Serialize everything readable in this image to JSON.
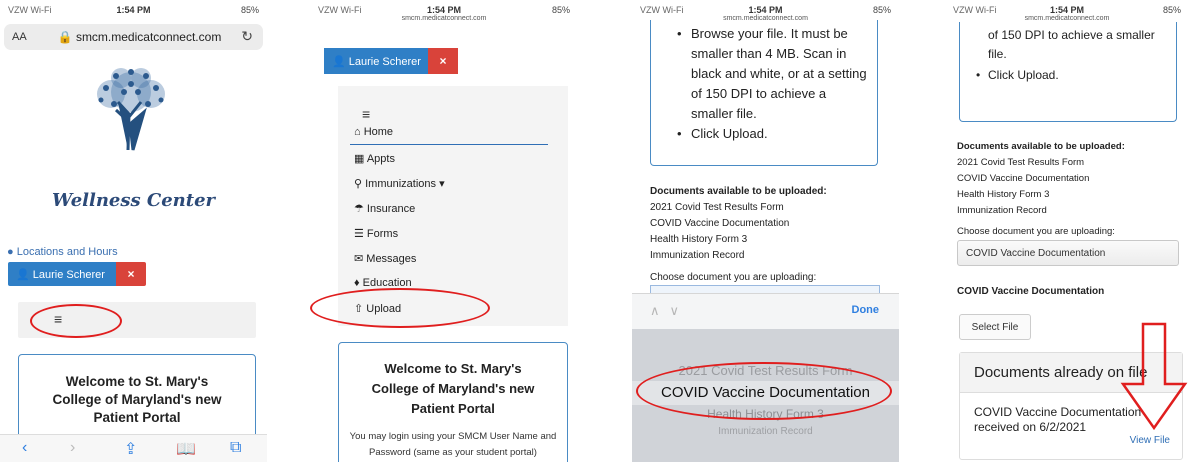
{
  "status": {
    "carrier": "VZW Wi-Fi",
    "time": "1:54 PM",
    "battery_p1": "85%",
    "battery_p2": "85%",
    "battery_p3": "85%",
    "battery_p4": "85%"
  },
  "phone1": {
    "url_aa": "AA",
    "url": "smcm.medicatconnect.com",
    "wellness_title": "Wellness Center",
    "locations_link": "Locations and Hours",
    "user_button": "Laurie Scherer",
    "close_label": "×",
    "menu_icon": "≡",
    "welcome_line1": "Welcome to St. Mary's",
    "welcome_line2": "College of Maryland's new",
    "welcome_line3": "Patient Portal"
  },
  "phone2": {
    "url": "smcm.medicatconnect.com",
    "user_button": "Laurie Scherer",
    "close_label": "×",
    "menu_icon": "≡",
    "nav": [
      "Home",
      "Appts",
      "Immunizations ▾",
      "Insurance",
      "Forms",
      "Messages",
      "Education",
      "Upload"
    ],
    "welcome_line1": "Welcome to St. Mary's",
    "welcome_line2": "College of Maryland's new",
    "welcome_line3": "Patient Portal",
    "welcome_body": "You may login using your SMCM User Name and Password (same as your student portal)"
  },
  "phone3": {
    "url": "smcm.medicatconnect.com",
    "instruction1": "Browse your file. It must be smaller than 4 MB. Scan in black and white, or at a setting of 150 DPI to achieve a smaller file.",
    "instruction2": "Click Upload.",
    "docs_title": "Documents available to be uploaded:",
    "docs": [
      "2021 Covid Test Results Form",
      "COVID Vaccine Documentation",
      "Health History Form 3",
      "Immunization Record"
    ],
    "choose_label": "Choose document you are uploading:",
    "done_label": "Done",
    "picker_options": [
      "2021 Covid Test Results Form",
      "COVID Vaccine Documentation",
      "Health History Form 3",
      "Immunization Record"
    ]
  },
  "phone4": {
    "url": "smcm.medicatconnect.com",
    "instruction_tail": "of 150 DPI to achieve a smaller file.",
    "instruction2": "Click Upload.",
    "docs_title": "Documents available to be uploaded:",
    "docs": [
      "2021 Covid Test Results Form",
      "COVID Vaccine Documentation",
      "Health History Form 3",
      "Immunization Record"
    ],
    "choose_label": "Choose document you are uploading:",
    "selected_value": "COVID Vaccine Documentation",
    "section_title": "COVID Vaccine Documentation",
    "select_file": "Select File",
    "onfile_title": "Documents already on file",
    "onfile_entry_line1": "COVID Vaccine Documentation",
    "onfile_entry_line2": "received on 6/2/2021",
    "view_file": "View File"
  },
  "colors": {
    "accent_blue": "#2f7fc6",
    "close_red": "#d9433a",
    "annotation_red": "#e01e1e"
  }
}
